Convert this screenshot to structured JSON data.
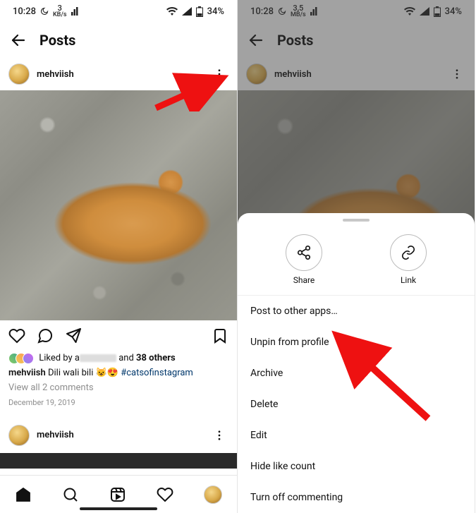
{
  "left": {
    "status": {
      "time": "10:28",
      "speed_value": "3",
      "speed_unit": "KB/s",
      "battery": "34%"
    },
    "header": {
      "title": "Posts"
    },
    "post": {
      "username": "mehviish",
      "liked_by_prefix": "Liked by a",
      "liked_by_others_conn": " and ",
      "liked_by_others": "38 others",
      "caption_user": "mehviish",
      "caption_text": " Dili wali bili 😺😍 ",
      "caption_hashtag": "#catsofinstagram",
      "comments": "View all 2 comments",
      "date": "December 19, 2019"
    },
    "next_post_user": "mehviish"
  },
  "right": {
    "status": {
      "time": "10:28",
      "speed_value": "3,5",
      "speed_unit": "MB/s",
      "battery": "34%"
    },
    "header": {
      "title": "Posts"
    },
    "post_username": "mehviish",
    "sheet": {
      "share": "Share",
      "link": "Link",
      "items": [
        "Post to other apps…",
        "Unpin from profile",
        "Archive",
        "Delete",
        "Edit",
        "Hide like count",
        "Turn off commenting"
      ]
    }
  }
}
